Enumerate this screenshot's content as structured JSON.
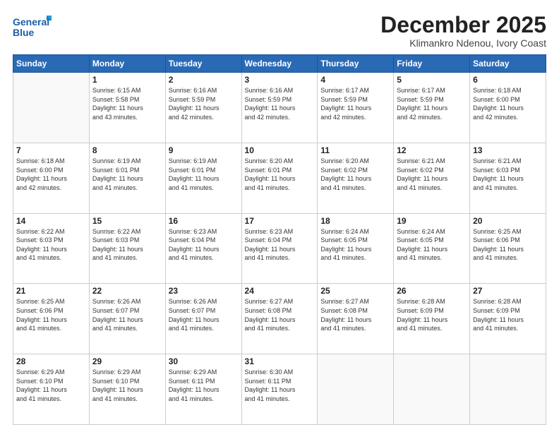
{
  "logo": {
    "line1": "General",
    "line2": "Blue"
  },
  "title": "December 2025",
  "subtitle": "Klimankro Ndenou, Ivory Coast",
  "header_days": [
    "Sunday",
    "Monday",
    "Tuesday",
    "Wednesday",
    "Thursday",
    "Friday",
    "Saturday"
  ],
  "weeks": [
    [
      {
        "day": "",
        "info": ""
      },
      {
        "day": "1",
        "info": "Sunrise: 6:15 AM\nSunset: 5:58 PM\nDaylight: 11 hours\nand 43 minutes."
      },
      {
        "day": "2",
        "info": "Sunrise: 6:16 AM\nSunset: 5:59 PM\nDaylight: 11 hours\nand 42 minutes."
      },
      {
        "day": "3",
        "info": "Sunrise: 6:16 AM\nSunset: 5:59 PM\nDaylight: 11 hours\nand 42 minutes."
      },
      {
        "day": "4",
        "info": "Sunrise: 6:17 AM\nSunset: 5:59 PM\nDaylight: 11 hours\nand 42 minutes."
      },
      {
        "day": "5",
        "info": "Sunrise: 6:17 AM\nSunset: 5:59 PM\nDaylight: 11 hours\nand 42 minutes."
      },
      {
        "day": "6",
        "info": "Sunrise: 6:18 AM\nSunset: 6:00 PM\nDaylight: 11 hours\nand 42 minutes."
      }
    ],
    [
      {
        "day": "7",
        "info": "Sunrise: 6:18 AM\nSunset: 6:00 PM\nDaylight: 11 hours\nand 42 minutes."
      },
      {
        "day": "8",
        "info": "Sunrise: 6:19 AM\nSunset: 6:01 PM\nDaylight: 11 hours\nand 41 minutes."
      },
      {
        "day": "9",
        "info": "Sunrise: 6:19 AM\nSunset: 6:01 PM\nDaylight: 11 hours\nand 41 minutes."
      },
      {
        "day": "10",
        "info": "Sunrise: 6:20 AM\nSunset: 6:01 PM\nDaylight: 11 hours\nand 41 minutes."
      },
      {
        "day": "11",
        "info": "Sunrise: 6:20 AM\nSunset: 6:02 PM\nDaylight: 11 hours\nand 41 minutes."
      },
      {
        "day": "12",
        "info": "Sunrise: 6:21 AM\nSunset: 6:02 PM\nDaylight: 11 hours\nand 41 minutes."
      },
      {
        "day": "13",
        "info": "Sunrise: 6:21 AM\nSunset: 6:03 PM\nDaylight: 11 hours\nand 41 minutes."
      }
    ],
    [
      {
        "day": "14",
        "info": "Sunrise: 6:22 AM\nSunset: 6:03 PM\nDaylight: 11 hours\nand 41 minutes."
      },
      {
        "day": "15",
        "info": "Sunrise: 6:22 AM\nSunset: 6:03 PM\nDaylight: 11 hours\nand 41 minutes."
      },
      {
        "day": "16",
        "info": "Sunrise: 6:23 AM\nSunset: 6:04 PM\nDaylight: 11 hours\nand 41 minutes."
      },
      {
        "day": "17",
        "info": "Sunrise: 6:23 AM\nSunset: 6:04 PM\nDaylight: 11 hours\nand 41 minutes."
      },
      {
        "day": "18",
        "info": "Sunrise: 6:24 AM\nSunset: 6:05 PM\nDaylight: 11 hours\nand 41 minutes."
      },
      {
        "day": "19",
        "info": "Sunrise: 6:24 AM\nSunset: 6:05 PM\nDaylight: 11 hours\nand 41 minutes."
      },
      {
        "day": "20",
        "info": "Sunrise: 6:25 AM\nSunset: 6:06 PM\nDaylight: 11 hours\nand 41 minutes."
      }
    ],
    [
      {
        "day": "21",
        "info": "Sunrise: 6:25 AM\nSunset: 6:06 PM\nDaylight: 11 hours\nand 41 minutes."
      },
      {
        "day": "22",
        "info": "Sunrise: 6:26 AM\nSunset: 6:07 PM\nDaylight: 11 hours\nand 41 minutes."
      },
      {
        "day": "23",
        "info": "Sunrise: 6:26 AM\nSunset: 6:07 PM\nDaylight: 11 hours\nand 41 minutes."
      },
      {
        "day": "24",
        "info": "Sunrise: 6:27 AM\nSunset: 6:08 PM\nDaylight: 11 hours\nand 41 minutes."
      },
      {
        "day": "25",
        "info": "Sunrise: 6:27 AM\nSunset: 6:08 PM\nDaylight: 11 hours\nand 41 minutes."
      },
      {
        "day": "26",
        "info": "Sunrise: 6:28 AM\nSunset: 6:09 PM\nDaylight: 11 hours\nand 41 minutes."
      },
      {
        "day": "27",
        "info": "Sunrise: 6:28 AM\nSunset: 6:09 PM\nDaylight: 11 hours\nand 41 minutes."
      }
    ],
    [
      {
        "day": "28",
        "info": "Sunrise: 6:29 AM\nSunset: 6:10 PM\nDaylight: 11 hours\nand 41 minutes."
      },
      {
        "day": "29",
        "info": "Sunrise: 6:29 AM\nSunset: 6:10 PM\nDaylight: 11 hours\nand 41 minutes."
      },
      {
        "day": "30",
        "info": "Sunrise: 6:29 AM\nSunset: 6:11 PM\nDaylight: 11 hours\nand 41 minutes."
      },
      {
        "day": "31",
        "info": "Sunrise: 6:30 AM\nSunset: 6:11 PM\nDaylight: 11 hours\nand 41 minutes."
      },
      {
        "day": "",
        "info": ""
      },
      {
        "day": "",
        "info": ""
      },
      {
        "day": "",
        "info": ""
      }
    ]
  ]
}
